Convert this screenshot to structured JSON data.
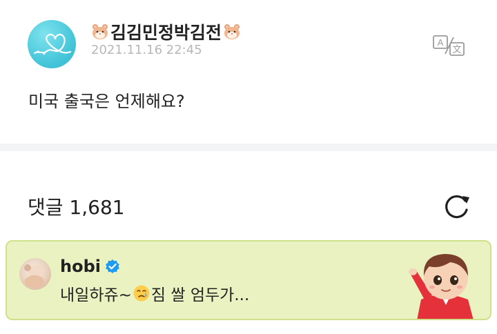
{
  "post": {
    "author_name": "김김민정박김전",
    "timestamp": "2021.11.16 22:45",
    "text": "미국 출국은 언제해요?",
    "translate_icon": "translate-icon"
  },
  "comments": {
    "title": "댓글 1,681",
    "refresh_icon": "refresh-icon"
  },
  "highlighted_comment": {
    "author": "hobi",
    "verified": true,
    "text_before_emoji": "내일하쥬~",
    "emoji": "crying-face-emoji",
    "text_after_emoji": " 짐 쌀 엄두가..."
  },
  "colors": {
    "card_background": "#eaf2c2",
    "card_border": "#cfe08a",
    "verified_blue": "#1d9bf0",
    "timestamp_gray": "#b7b7b7"
  }
}
